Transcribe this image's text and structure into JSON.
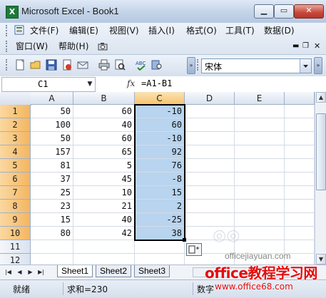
{
  "window": {
    "title": "Microsoft Excel - Book1",
    "app_icon": "excel-icon"
  },
  "menu": {
    "row1": [
      "文件(F)",
      "编辑(E)",
      "视图(V)",
      "插入(I)",
      "格式(O)",
      "工具(T)",
      "数据(D)"
    ],
    "row2": [
      "窗口(W)",
      "帮助(H)"
    ]
  },
  "toolbar": {
    "font_name": "宋体"
  },
  "formula_bar": {
    "name_box": "C1",
    "fx": "fx",
    "formula": "=A1-B1"
  },
  "columns": [
    "A",
    "B",
    "C",
    "D",
    "E"
  ],
  "rows": [
    {
      "n": "1",
      "a": "50",
      "b": "60",
      "c": "-10"
    },
    {
      "n": "2",
      "a": "100",
      "b": "40",
      "c": "60"
    },
    {
      "n": "3",
      "a": "50",
      "b": "60",
      "c": "-10"
    },
    {
      "n": "4",
      "a": "157",
      "b": "65",
      "c": "92"
    },
    {
      "n": "5",
      "a": "81",
      "b": "5",
      "c": "76"
    },
    {
      "n": "6",
      "a": "37",
      "b": "45",
      "c": "-8"
    },
    {
      "n": "7",
      "a": "25",
      "b": "10",
      "c": "15"
    },
    {
      "n": "8",
      "a": "23",
      "b": "21",
      "c": "2"
    },
    {
      "n": "9",
      "a": "15",
      "b": "40",
      "c": "-25"
    },
    {
      "n": "10",
      "a": "80",
      "b": "42",
      "c": "38"
    },
    {
      "n": "11",
      "a": "",
      "b": "",
      "c": ""
    },
    {
      "n": "12",
      "a": "",
      "b": "",
      "c": ""
    }
  ],
  "sheets": [
    "Sheet1",
    "Sheet2",
    "Sheet3"
  ],
  "active_sheet": "Sheet1",
  "status": {
    "mode": "就绪",
    "sum": "求和=230",
    "num": "数字"
  },
  "watermark": {
    "text1": "office教程学习网",
    "text2": "www.office68.com",
    "text3": "officejiayuan.com"
  },
  "colors": {
    "accent": "#b8d4ee",
    "selected_header": "#f5c46d",
    "watermark": "#e30d0d"
  }
}
